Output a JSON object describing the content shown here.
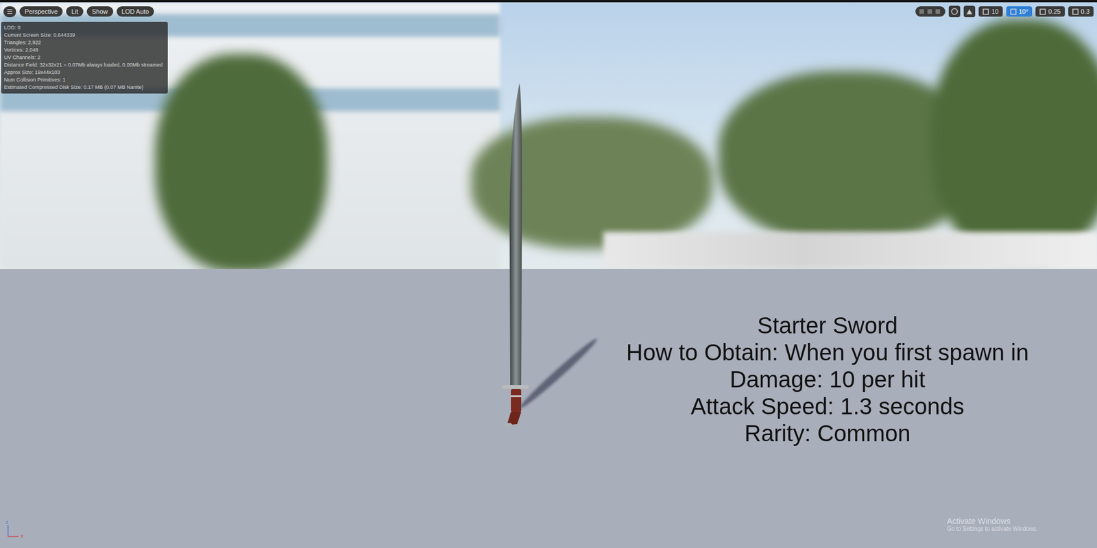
{
  "viewport_toolbar": {
    "menu": "☰",
    "buttons": [
      {
        "label": "Perspective"
      },
      {
        "label": "Lit"
      },
      {
        "label": "Show"
      },
      {
        "label": "LOD Auto"
      }
    ],
    "right_tools": [
      {
        "label": "10",
        "selected": false
      },
      {
        "label": "10°",
        "selected": true
      },
      {
        "label": "0.25",
        "selected": false
      },
      {
        "label": "0.3",
        "selected": false
      }
    ]
  },
  "stats": [
    "LOD: 0",
    "Current Screen Size: 0.644339",
    "Triangles: 2,922",
    "Vertices: 2,048",
    "UV Channels: 2",
    "Distance Field: 32x32x21 = 0.07Mb always loaded, 0.00Mb streamed",
    "Approx Size: 19x44x103",
    "Num Collision Primitives: 1",
    "Estimated Compressed Disk Size: 0.17 MB (0.07 MB Nanite)"
  ],
  "item_card": {
    "name": "Starter Sword",
    "lines": [
      "How to Obtain: When you first spawn in",
      "Damage: 10 per hit",
      "Attack Speed: 1.3 seconds",
      "Rarity: Common"
    ]
  },
  "axis_labels": [
    "z",
    "x"
  ],
  "watermark": {
    "title": "Activate Windows",
    "subtitle": "Go to Settings to activate Windows."
  }
}
